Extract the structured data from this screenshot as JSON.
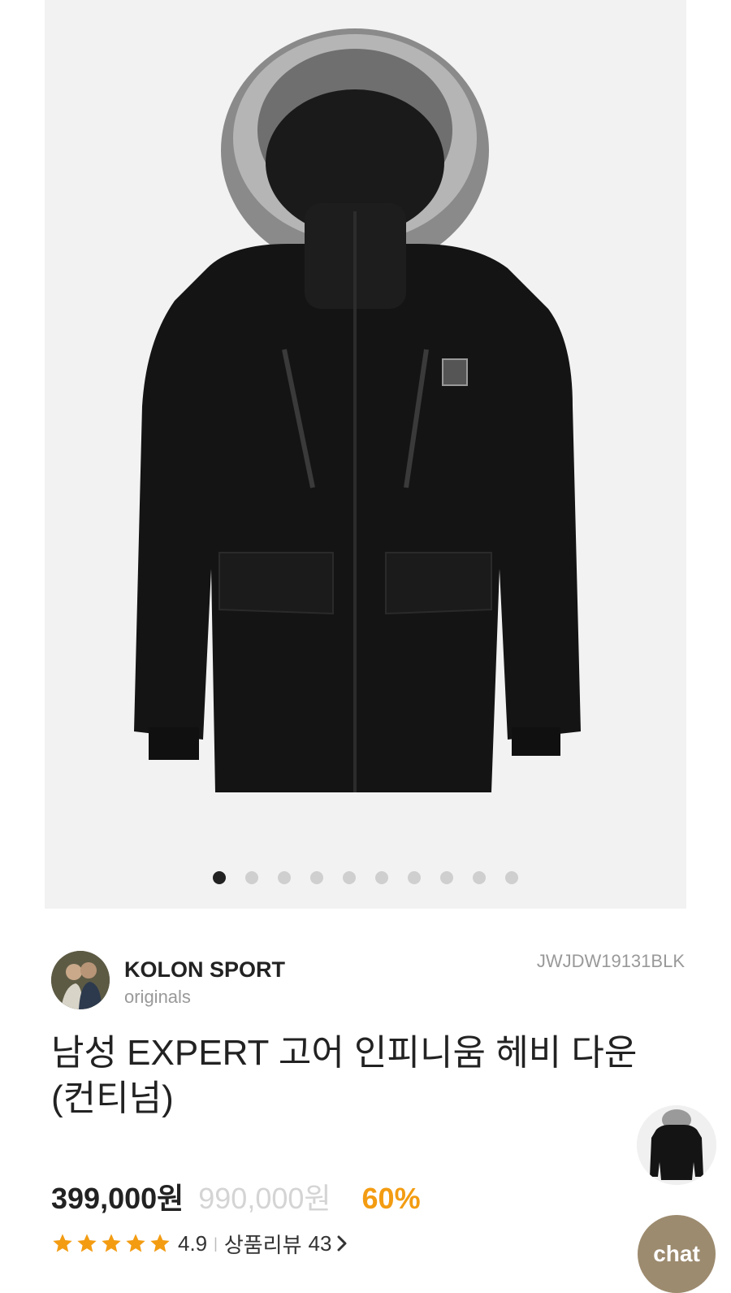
{
  "gallery": {
    "image_count": 10,
    "active_index": 0
  },
  "brand": {
    "name": "KOLON SPORT",
    "subtitle": "originals",
    "sku": "JWJDW19131BLK"
  },
  "product": {
    "title_line1": "남성 EXPERT 고어 인피니움 헤비 다운",
    "title_line2": "(컨티넘)"
  },
  "price": {
    "sale": "399,000원",
    "original": "990,000원",
    "discount": "60%"
  },
  "rating": {
    "score": "4.9",
    "stars": 5,
    "separator": "|",
    "review_label": "상품리뷰",
    "review_count": "43"
  },
  "chat": {
    "label": "chat"
  },
  "colors": {
    "discount": "#f39c12",
    "star": "#f39c12",
    "chat_bg": "#9d8b6f",
    "gallery_bg": "#f2f2f2"
  },
  "icons": {
    "star": "star-icon",
    "chevron": "chevron-right-icon"
  }
}
